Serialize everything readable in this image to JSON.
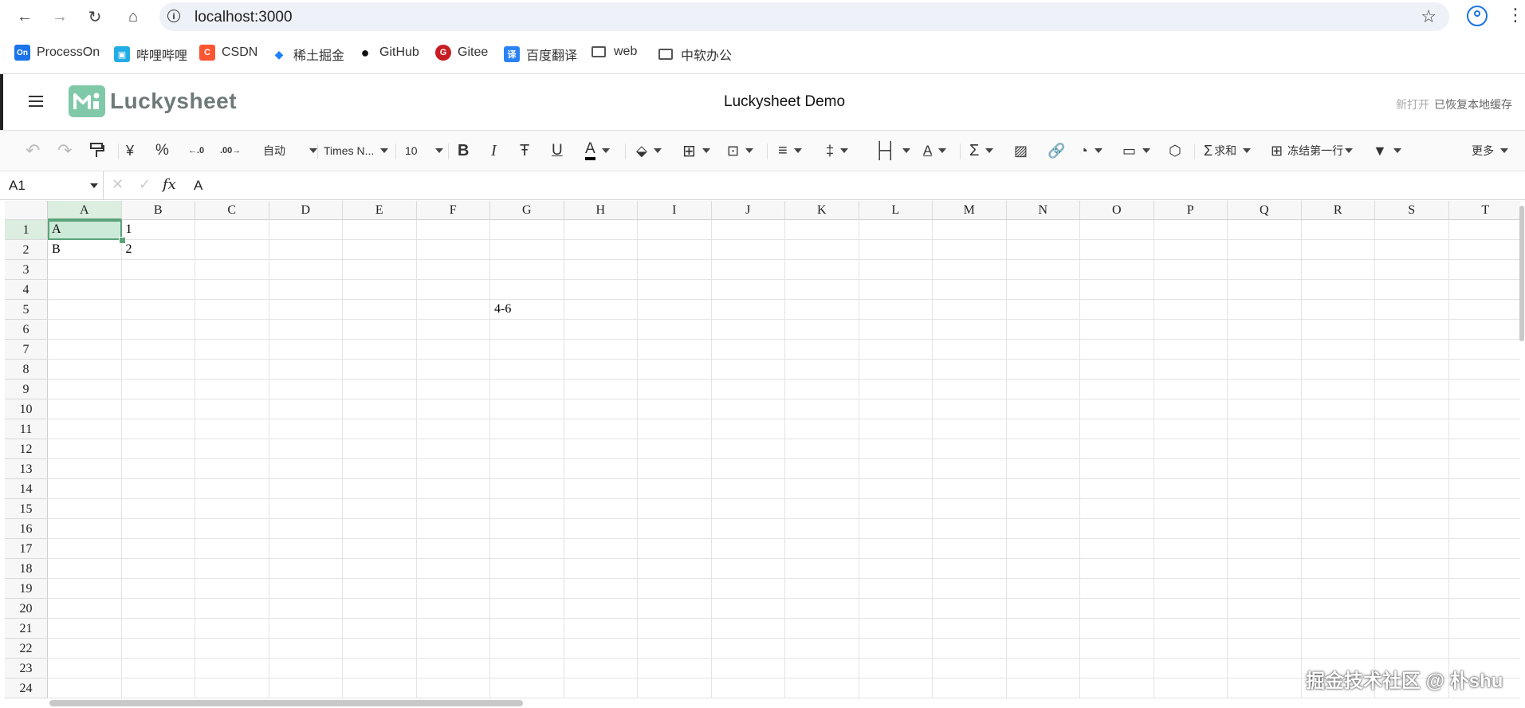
{
  "browser": {
    "url": "localhost:3000",
    "bookmarks": [
      {
        "label": "ProcessOn",
        "icon": "processon-icon",
        "color": "#1a73e8",
        "glyph": "On"
      },
      {
        "label": "哔哩哔哩",
        "icon": "bilibili-icon",
        "color": "#23ade5",
        "glyph": "▣"
      },
      {
        "label": "CSDN",
        "icon": "csdn-icon",
        "color": "#fc5531",
        "glyph": "C"
      },
      {
        "label": "稀土掘金",
        "icon": "juejin-icon",
        "color": "#1e80ff",
        "glyph": "◆"
      },
      {
        "label": "GitHub",
        "icon": "github-icon",
        "color": "#111111",
        "glyph": "●"
      },
      {
        "label": "Gitee",
        "icon": "gitee-icon",
        "color": "#c71d23",
        "glyph": "G"
      },
      {
        "label": "百度翻译",
        "icon": "baidu-translate-icon",
        "color": "#2b82f6",
        "glyph": "译"
      },
      {
        "label": "web",
        "icon": "folder-icon"
      },
      {
        "label": "中软办公",
        "icon": "folder-icon"
      }
    ]
  },
  "header": {
    "logo_text": "Luckysheet",
    "title": "Luckysheet Demo",
    "new_open": "新打开",
    "restored": "已恢复本地缓存"
  },
  "toolbar": {
    "currency": "¥",
    "percent": "%",
    "dec_increase": ".0",
    "dec_decrease": ".00",
    "format": "自动",
    "font": "Times N...",
    "size": "10",
    "bold": "B",
    "italic": "I",
    "strike": "Ŧ",
    "underline": "U",
    "text_color": "A",
    "sum": "求和",
    "freeze": "冻结第一行",
    "more": "更多"
  },
  "formula_bar": {
    "cell_ref": "A1",
    "fx": "fx",
    "value": "A"
  },
  "sheet": {
    "columns": [
      "A",
      "B",
      "C",
      "D",
      "E",
      "F",
      "G",
      "H",
      "I",
      "J",
      "K",
      "L",
      "M",
      "N",
      "O",
      "P",
      "Q",
      "R",
      "S",
      "T"
    ],
    "rows": [
      "1",
      "2",
      "3",
      "4",
      "5",
      "6",
      "7",
      "8",
      "9",
      "10",
      "11",
      "12",
      "13",
      "14",
      "15",
      "16",
      "17",
      "18",
      "19",
      "20",
      "21",
      "22",
      "23",
      "24"
    ],
    "cells": [
      {
        "ref": "A1",
        "value": "A"
      },
      {
        "ref": "B1",
        "value": "1"
      },
      {
        "ref": "A2",
        "value": "B"
      },
      {
        "ref": "B2",
        "value": "2"
      },
      {
        "ref": "G5",
        "value": "4-6"
      }
    ],
    "selected": "A1",
    "accent": "#5ba47b"
  },
  "watermark": "掘金技术社区 @ 朴shu"
}
